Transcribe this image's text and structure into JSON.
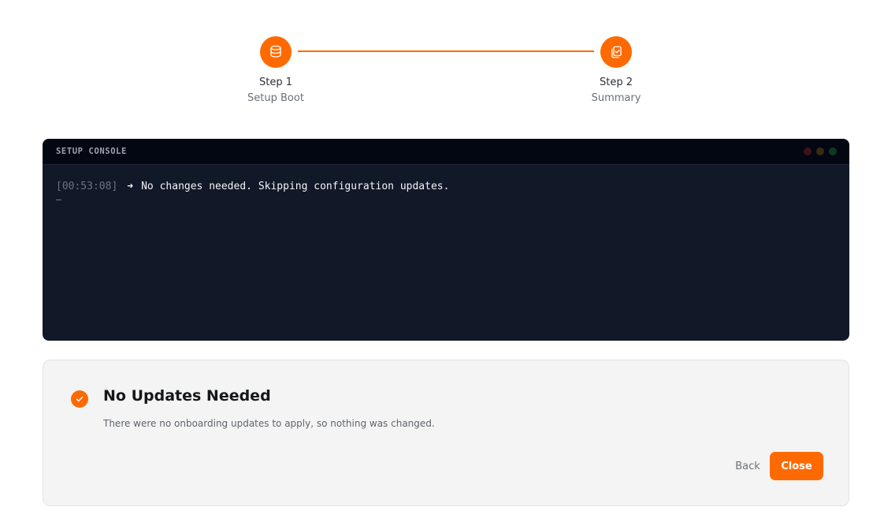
{
  "stepper": {
    "steps": [
      {
        "title": "Step 1",
        "subtitle": "Setup Boot",
        "icon": "database-icon"
      },
      {
        "title": "Step 2",
        "subtitle": "Summary",
        "icon": "clipboard-check-icon"
      }
    ],
    "accent": "#ff6a00"
  },
  "console": {
    "title": "SETUP CONSOLE",
    "lines": [
      {
        "time": "[00:53:08]",
        "arrow": "➜",
        "message": "No changes needed. Skipping configuration updates."
      }
    ],
    "cursor": "_",
    "colors": {
      "background": "#111827",
      "header": "#030712"
    }
  },
  "result": {
    "icon": "check-circle-icon",
    "title": "No Updates Needed",
    "description": "There were no onboarding updates to apply, so nothing was changed.",
    "back_label": "Back",
    "close_label": "Close"
  }
}
